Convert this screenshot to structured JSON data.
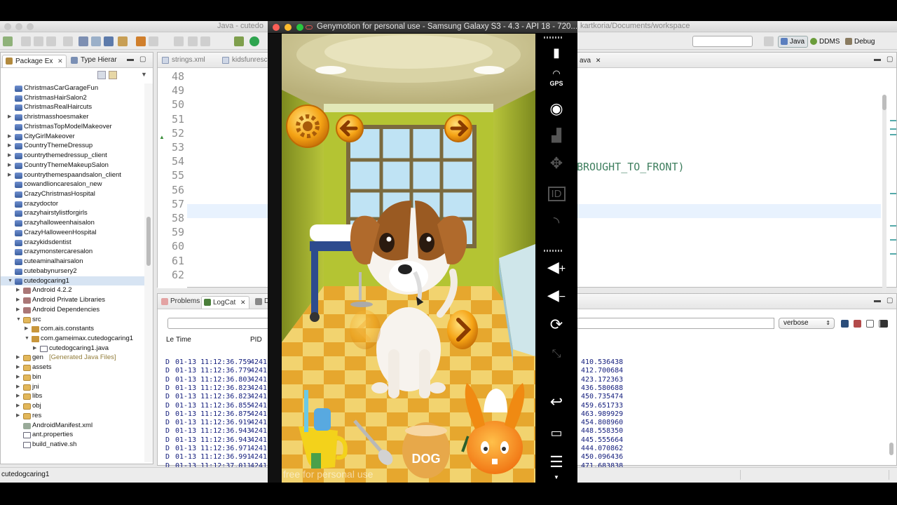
{
  "eclipse": {
    "title_left": "Java - cutedo",
    "title_right": "kartkoria/Documents/workspace",
    "perspectives": [
      "Java",
      "DDMS",
      "Debug"
    ],
    "package_explorer": {
      "tabs": [
        {
          "label": "Package Ex"
        },
        {
          "label": "Type Hierar"
        }
      ],
      "tree": [
        {
          "label": "ChristmasCarGarageFun",
          "depth": 0,
          "arrow": "",
          "icon": "proj"
        },
        {
          "label": "ChristmasHairSalon2",
          "depth": 0,
          "arrow": "",
          "icon": "proj"
        },
        {
          "label": "ChristmasRealHaircuts",
          "depth": 0,
          "arrow": "",
          "icon": "proj"
        },
        {
          "label": "christmasshoesmaker",
          "depth": 0,
          "arrow": "▶",
          "icon": "proj"
        },
        {
          "label": "ChristmasTopModelMakeover",
          "depth": 0,
          "arrow": "",
          "icon": "proj"
        },
        {
          "label": "CityGirlMakeover",
          "depth": 0,
          "arrow": "▶",
          "icon": "proj"
        },
        {
          "label": "CountryThemeDressup",
          "depth": 0,
          "arrow": "▶",
          "icon": "proj"
        },
        {
          "label": "countrythemedressup_client",
          "depth": 0,
          "arrow": "▶",
          "icon": "proj"
        },
        {
          "label": "CountryThemeMakeupSalon",
          "depth": 0,
          "arrow": "▶",
          "icon": "proj"
        },
        {
          "label": "countrythemespaandsalon_client",
          "depth": 0,
          "arrow": "▶",
          "icon": "proj"
        },
        {
          "label": "cowandlioncaresalon_new",
          "depth": 0,
          "arrow": "",
          "icon": "proj"
        },
        {
          "label": "CrazyChristmasHospital",
          "depth": 0,
          "arrow": "",
          "icon": "proj"
        },
        {
          "label": "crazydoctor",
          "depth": 0,
          "arrow": "",
          "icon": "proj"
        },
        {
          "label": "crazyhairstylistforgirls",
          "depth": 0,
          "arrow": "",
          "icon": "proj"
        },
        {
          "label": "crazyhalloweenhaisalon",
          "depth": 0,
          "arrow": "",
          "icon": "proj"
        },
        {
          "label": "CrazyHalloweenHospital",
          "depth": 0,
          "arrow": "",
          "icon": "proj"
        },
        {
          "label": "crazykidsdentist",
          "depth": 0,
          "arrow": "",
          "icon": "proj"
        },
        {
          "label": "crazymonstercaresalon",
          "depth": 0,
          "arrow": "",
          "icon": "proj"
        },
        {
          "label": "cuteaminalhairsalon",
          "depth": 0,
          "arrow": "",
          "icon": "proj"
        },
        {
          "label": "cutebabynursery2",
          "depth": 0,
          "arrow": "",
          "icon": "proj"
        },
        {
          "label": "cutedogcaring1",
          "depth": 0,
          "arrow": "▼",
          "icon": "proj",
          "selected": true
        },
        {
          "label": "Android 4.2.2",
          "depth": 1,
          "arrow": "▶",
          "icon": "lib"
        },
        {
          "label": "Android Private Libraries",
          "depth": 1,
          "arrow": "▶",
          "icon": "lib"
        },
        {
          "label": "Android Dependencies",
          "depth": 1,
          "arrow": "▶",
          "icon": "lib"
        },
        {
          "label": "src",
          "depth": 1,
          "arrow": "▼",
          "icon": "folder"
        },
        {
          "label": "com.ais.constants",
          "depth": 2,
          "arrow": "▶",
          "icon": "pkg"
        },
        {
          "label": "com.gameimax.cutedogcaring1",
          "depth": 2,
          "arrow": "▼",
          "icon": "pkg"
        },
        {
          "label": "cutedogcaring1.java",
          "depth": 3,
          "arrow": "▶",
          "icon": "file"
        },
        {
          "label": "gen",
          "note": "[Generated Java Files]",
          "depth": 1,
          "arrow": "▶",
          "icon": "folder"
        },
        {
          "label": "assets",
          "depth": 1,
          "arrow": "▶",
          "icon": "folder"
        },
        {
          "label": "bin",
          "depth": 1,
          "arrow": "▶",
          "icon": "folder"
        },
        {
          "label": "jni",
          "depth": 1,
          "arrow": "▶",
          "icon": "folder"
        },
        {
          "label": "libs",
          "depth": 1,
          "arrow": "▶",
          "icon": "folder"
        },
        {
          "label": "obj",
          "depth": 1,
          "arrow": "▶",
          "icon": "folder"
        },
        {
          "label": "res",
          "depth": 1,
          "arrow": "▶",
          "icon": "folder"
        },
        {
          "label": "AndroidManifest.xml",
          "depth": 1,
          "arrow": "",
          "icon": "mf"
        },
        {
          "label": "ant.properties",
          "depth": 1,
          "arrow": "",
          "icon": "file"
        },
        {
          "label": "build_native.sh",
          "depth": 1,
          "arrow": "",
          "icon": "file"
        }
      ]
    },
    "editor": {
      "tabs": [
        "strings.xml",
        "kidsfunrescu",
        "ava"
      ],
      "line_numbers": [
        "48",
        "49",
        "50",
        "51",
        "52",
        "53",
        "54",
        "55",
        "56",
        "57",
        "58",
        "59",
        "60",
        "61",
        "62"
      ],
      "code_right": "BROUGHT_TO_FRONT)"
    },
    "bottom": {
      "tabs": [
        "Problems",
        "LogCat",
        "D"
      ],
      "level": "verbose",
      "headers": {
        "level": "Le",
        "time": "Time",
        "pid": "PID"
      },
      "rows": [
        {
          "level": "D",
          "time": "01-13 11:12:36.759",
          "pid": "4241",
          "msg": "410.536438"
        },
        {
          "level": "D",
          "time": "01-13 11:12:36.779",
          "pid": "4241",
          "msg": "412.700684"
        },
        {
          "level": "D",
          "time": "01-13 11:12:36.803",
          "pid": "4241",
          "msg": "423.172363"
        },
        {
          "level": "D",
          "time": "01-13 11:12:36.823",
          "pid": "4241",
          "msg": "436.580688"
        },
        {
          "level": "D",
          "time": "01-13 11:12:36.823",
          "pid": "4241",
          "msg": "450.735474"
        },
        {
          "level": "D",
          "time": "01-13 11:12:36.855",
          "pid": "4241",
          "msg": "459.651733"
        },
        {
          "level": "D",
          "time": "01-13 11:12:36.875",
          "pid": "4241",
          "msg": "463.989929"
        },
        {
          "level": "D",
          "time": "01-13 11:12:36.919",
          "pid": "4241",
          "msg": "454.808960"
        },
        {
          "level": "D",
          "time": "01-13 11:12:36.943",
          "pid": "4241",
          "msg": "448.558350"
        },
        {
          "level": "D",
          "time": "01-13 11:12:36.943",
          "pid": "4241",
          "msg": "445.555664"
        },
        {
          "level": "D",
          "time": "01-13 11:12:36.971",
          "pid": "4241",
          "msg": "444.070862"
        },
        {
          "level": "D",
          "time": "01-13 11:12:36.991",
          "pid": "4241",
          "msg": "450.096436"
        },
        {
          "level": "D",
          "time": "01-13 11:12:37.011",
          "pid": "4241",
          "msg": "471.683838"
        }
      ]
    },
    "status": "cutedogcaring1"
  },
  "genymotion": {
    "title": "Genymotion for personal use - Samsung Galaxy S3 - 4.3 - API 18 - 720...",
    "watermark": "free for personal use",
    "side_buttons": {
      "battery": "battery-icon",
      "gps": "GPS",
      "camera": "webcam-icon",
      "id": "ID",
      "volume_up": "+",
      "volume_down": "−"
    },
    "game": {
      "bowl_label": "DOG"
    }
  }
}
